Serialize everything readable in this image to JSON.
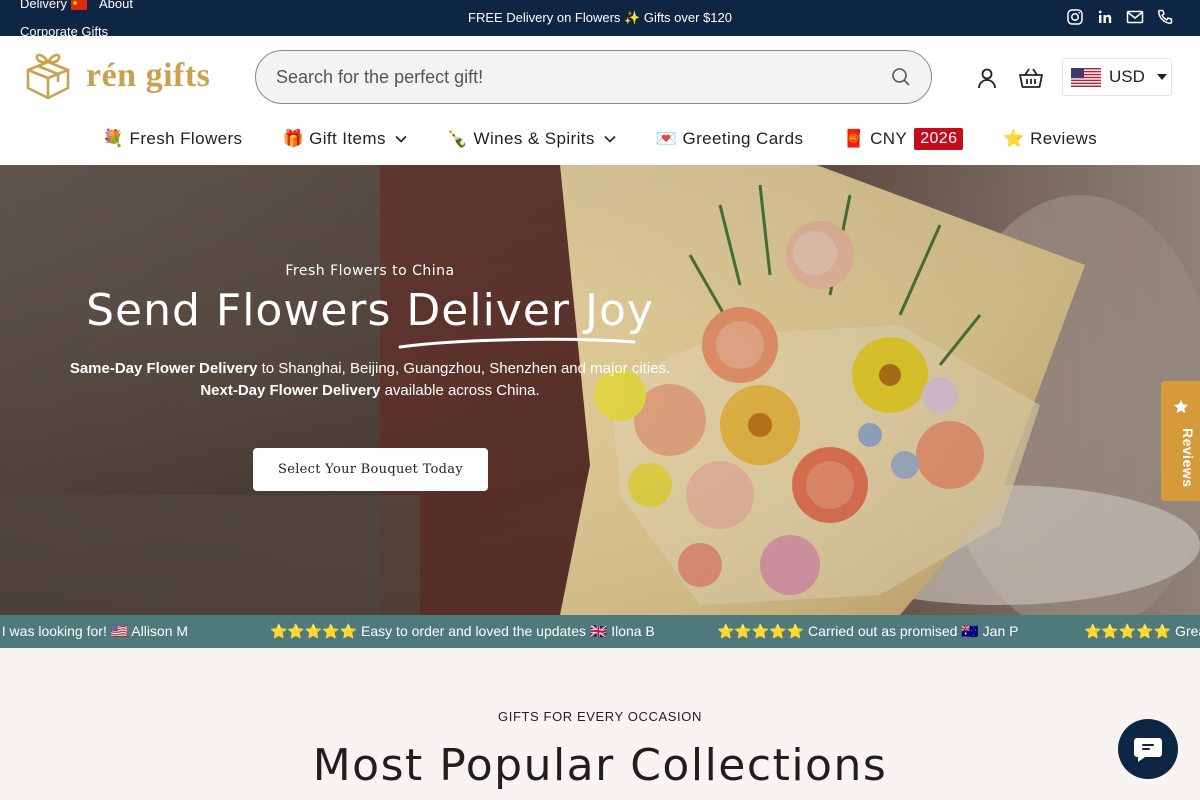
{
  "topbar": {
    "delivery_label": "Delivery",
    "about_label": "About",
    "corporate_label": "Corporate Gifts",
    "announcement": "FREE Delivery on Flowers ✨ Gifts over $120"
  },
  "header": {
    "brand": "rén gifts",
    "search_placeholder": "Search for the perfect gift!",
    "currency": "USD"
  },
  "nav": {
    "fresh_flowers": "💐 Fresh Flowers",
    "gift_items": "🎁 Gift Items",
    "wines_spirits": "🍾 Wines & Spirits",
    "greeting_cards": "💌 Greeting Cards",
    "cny": "🧧 CNY",
    "cny_badge": "2026",
    "reviews": "⭐ Reviews"
  },
  "hero": {
    "eyebrow": "Fresh Flowers to China",
    "headline_part1": "Send Flowers ",
    "headline_part2": "Deliver Joy",
    "sub1_bold": "Same-Day Flower Delivery",
    "sub1_rest": " to Shanghai, Beijing, Guangzhou, Shenzhen and major cities.",
    "sub2_bold": "Next-Day Flower Delivery",
    "sub2_rest": " available across China.",
    "cta": "Select Your Bouquet Today"
  },
  "reviews_tab": {
    "label": "Reviews"
  },
  "marquee": {
    "items": [
      "t I was looking for! 🇺🇸 Allison M",
      "⭐⭐⭐⭐⭐ Easy to order and loved the updates 🇬🇧 Ilona B",
      "⭐⭐⭐⭐⭐ Carried out as promised 🇦🇺 Jan P",
      "⭐⭐⭐⭐⭐ Great"
    ]
  },
  "collections": {
    "eyebrow": "GIFTS FOR EVERY OCCASION",
    "title": "Most Popular Collections"
  },
  "colors": {
    "topbar_bg": "#0f2544",
    "brand_gold": "#c9a24e",
    "marquee_bg": "#4e7a7b",
    "reviews_tab": "#d59a3a",
    "cny_badge": "#c40c1c"
  }
}
